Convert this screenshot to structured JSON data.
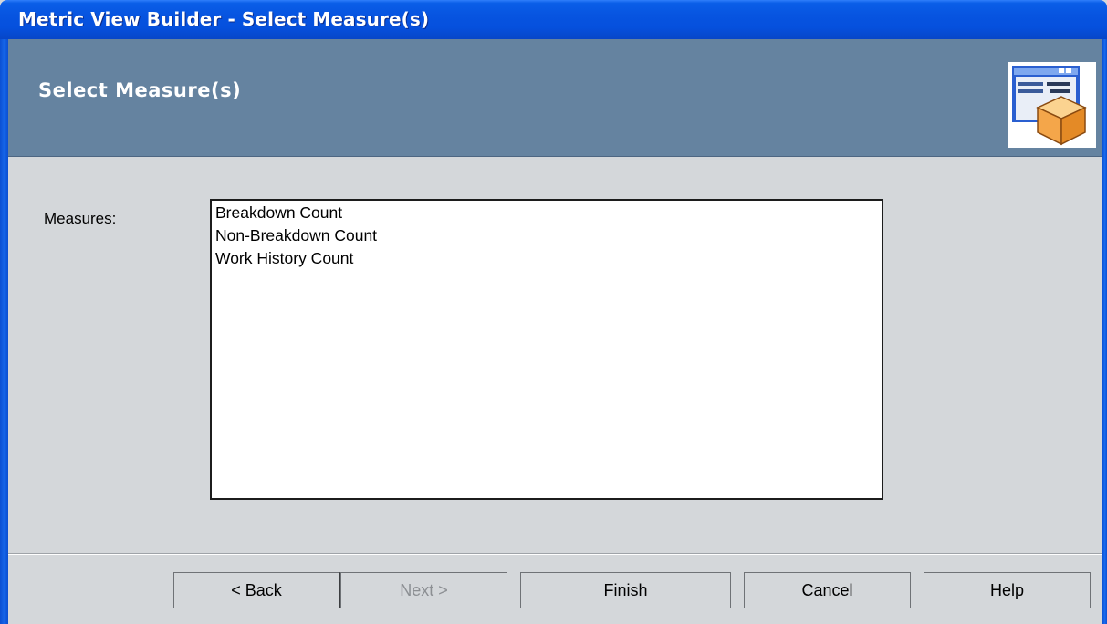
{
  "window": {
    "title": "Metric View Builder - Select Measure(s)"
  },
  "header": {
    "title": "Select Measure(s)",
    "icon": "wizard-cube-icon"
  },
  "form": {
    "measures_label": "Measures:",
    "measures": [
      "Breakdown Count",
      "Non-Breakdown Count",
      "Work History Count"
    ]
  },
  "buttons": {
    "back": "< Back",
    "next": "Next >",
    "finish": "Finish",
    "cancel": "Cancel",
    "help": "Help"
  },
  "colors": {
    "titlebar": "#0754e0",
    "header_band": "#6583a0",
    "dialog_face": "#d4d7da",
    "icon_orange": "#f0a040"
  }
}
